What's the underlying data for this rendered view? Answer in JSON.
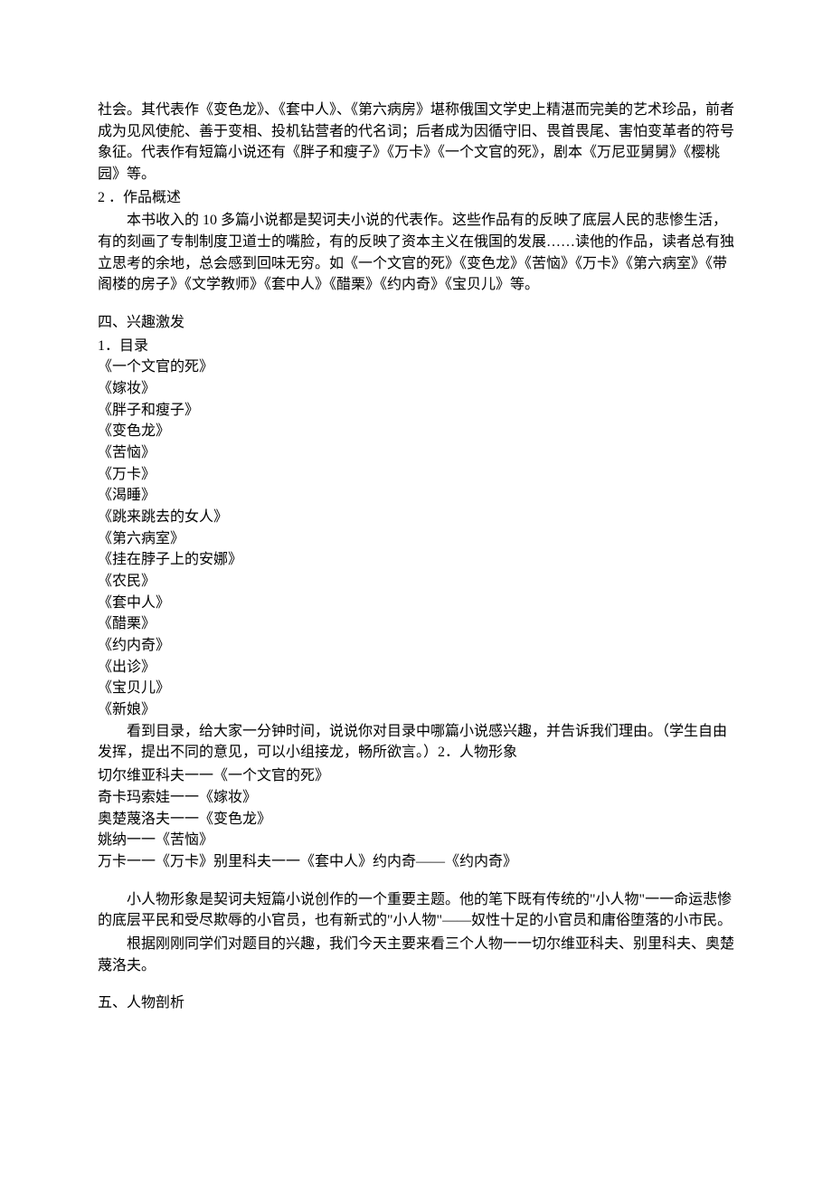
{
  "p1": "社会。其代表作《变色龙》、《套中人》、《第六病房》堪称俄国文学史上精湛而完美的艺术珍品，前者成为见风使舵、善于变相、投机钻营者的代名词；后者成为因循守旧、畏首畏尾、害怕变革者的符号象征。代表作有短篇小说还有《胖子和瘦子》《万卡》《一个文官的死》，剧本《万尼亚舅舅》《樱桃园》等。",
  "p2_label": "2 ．作品概述",
  "p3": "本书收入的 10 多篇小说都是契诃夫小说的代表作。这些作品有的反映了底层人民的悲惨生活，有的刻画了专制制度卫道士的嘴脸，有的反映了资本主义在俄国的发展……读他的作品，读者总有独立思考的余地，总会感到回味无穷。如《一个文官的死》《变色龙》《苦恼》《万卡》《第六病室》《带阁楼的房子》《文学教师》《套中人》《醋栗》《约内奇》《宝贝儿》等。",
  "sec4": "四、兴趣激发",
  "toc_label": "1．目录",
  "toc": [
    "《一个文官的死》",
    "《嫁妆》",
    "《胖子和瘦子》",
    "《变色龙》",
    "《苦恼》",
    "《万卡》",
    "《渴睡》",
    "《跳来跳去的女人》",
    "《第六病室》",
    "《挂在脖子上的安娜》",
    "《农民》",
    "《套中人》",
    "《醋栗》",
    "《约内奇》",
    "《出诊》",
    "《宝贝儿》",
    "《新娘》"
  ],
  "p4": "看到目录，给大家一分钟时间，说说你对目录中哪篇小说感兴趣，并告诉我们理由。（学生自由发挥，提出不同的意见，可以小组接龙，畅所欲言。）2．人物形象",
  "chars": [
    "切尔维亚科夫一一《一个文官的死》",
    "奇卡玛索娃一一《嫁妆》",
    "奥楚蔑洛夫一一《变色龙》",
    "姚纳一一《苦恼》",
    "万卡一一《万卡》别里科夫一一《套中人》约内奇——《约内奇》"
  ],
  "p5": "小人物形象是契诃夫短篇小说创作的一个重要主题。他的笔下既有传统的\"小人物\"一一命运悲惨的底层平民和受尽欺辱的小官员，也有新式的\"小人物\"——奴性十足的小官员和庸俗堕落的小市民。",
  "p6": "根据刚刚同学们对题目的兴趣，我们今天主要来看三个人物一一切尔维亚科夫、别里科夫、奥楚蔑洛夫。",
  "sec5": "五、人物剖析"
}
